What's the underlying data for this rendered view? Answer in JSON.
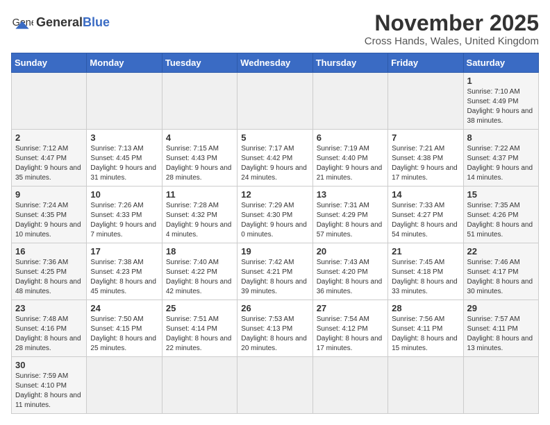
{
  "logo": {
    "text_general": "General",
    "text_blue": "Blue"
  },
  "header": {
    "month": "November 2025",
    "location": "Cross Hands, Wales, United Kingdom"
  },
  "weekdays": [
    "Sunday",
    "Monday",
    "Tuesday",
    "Wednesday",
    "Thursday",
    "Friday",
    "Saturday"
  ],
  "weeks": [
    [
      {
        "day": "",
        "info": ""
      },
      {
        "day": "",
        "info": ""
      },
      {
        "day": "",
        "info": ""
      },
      {
        "day": "",
        "info": ""
      },
      {
        "day": "",
        "info": ""
      },
      {
        "day": "",
        "info": ""
      },
      {
        "day": "1",
        "info": "Sunrise: 7:10 AM\nSunset: 4:49 PM\nDaylight: 9 hours and 38 minutes."
      }
    ],
    [
      {
        "day": "2",
        "info": "Sunrise: 7:12 AM\nSunset: 4:47 PM\nDaylight: 9 hours and 35 minutes."
      },
      {
        "day": "3",
        "info": "Sunrise: 7:13 AM\nSunset: 4:45 PM\nDaylight: 9 hours and 31 minutes."
      },
      {
        "day": "4",
        "info": "Sunrise: 7:15 AM\nSunset: 4:43 PM\nDaylight: 9 hours and 28 minutes."
      },
      {
        "day": "5",
        "info": "Sunrise: 7:17 AM\nSunset: 4:42 PM\nDaylight: 9 hours and 24 minutes."
      },
      {
        "day": "6",
        "info": "Sunrise: 7:19 AM\nSunset: 4:40 PM\nDaylight: 9 hours and 21 minutes."
      },
      {
        "day": "7",
        "info": "Sunrise: 7:21 AM\nSunset: 4:38 PM\nDaylight: 9 hours and 17 minutes."
      },
      {
        "day": "8",
        "info": "Sunrise: 7:22 AM\nSunset: 4:37 PM\nDaylight: 9 hours and 14 minutes."
      }
    ],
    [
      {
        "day": "9",
        "info": "Sunrise: 7:24 AM\nSunset: 4:35 PM\nDaylight: 9 hours and 10 minutes."
      },
      {
        "day": "10",
        "info": "Sunrise: 7:26 AM\nSunset: 4:33 PM\nDaylight: 9 hours and 7 minutes."
      },
      {
        "day": "11",
        "info": "Sunrise: 7:28 AM\nSunset: 4:32 PM\nDaylight: 9 hours and 4 minutes."
      },
      {
        "day": "12",
        "info": "Sunrise: 7:29 AM\nSunset: 4:30 PM\nDaylight: 9 hours and 0 minutes."
      },
      {
        "day": "13",
        "info": "Sunrise: 7:31 AM\nSunset: 4:29 PM\nDaylight: 8 hours and 57 minutes."
      },
      {
        "day": "14",
        "info": "Sunrise: 7:33 AM\nSunset: 4:27 PM\nDaylight: 8 hours and 54 minutes."
      },
      {
        "day": "15",
        "info": "Sunrise: 7:35 AM\nSunset: 4:26 PM\nDaylight: 8 hours and 51 minutes."
      }
    ],
    [
      {
        "day": "16",
        "info": "Sunrise: 7:36 AM\nSunset: 4:25 PM\nDaylight: 8 hours and 48 minutes."
      },
      {
        "day": "17",
        "info": "Sunrise: 7:38 AM\nSunset: 4:23 PM\nDaylight: 8 hours and 45 minutes."
      },
      {
        "day": "18",
        "info": "Sunrise: 7:40 AM\nSunset: 4:22 PM\nDaylight: 8 hours and 42 minutes."
      },
      {
        "day": "19",
        "info": "Sunrise: 7:42 AM\nSunset: 4:21 PM\nDaylight: 8 hours and 39 minutes."
      },
      {
        "day": "20",
        "info": "Sunrise: 7:43 AM\nSunset: 4:20 PM\nDaylight: 8 hours and 36 minutes."
      },
      {
        "day": "21",
        "info": "Sunrise: 7:45 AM\nSunset: 4:18 PM\nDaylight: 8 hours and 33 minutes."
      },
      {
        "day": "22",
        "info": "Sunrise: 7:46 AM\nSunset: 4:17 PM\nDaylight: 8 hours and 30 minutes."
      }
    ],
    [
      {
        "day": "23",
        "info": "Sunrise: 7:48 AM\nSunset: 4:16 PM\nDaylight: 8 hours and 28 minutes."
      },
      {
        "day": "24",
        "info": "Sunrise: 7:50 AM\nSunset: 4:15 PM\nDaylight: 8 hours and 25 minutes."
      },
      {
        "day": "25",
        "info": "Sunrise: 7:51 AM\nSunset: 4:14 PM\nDaylight: 8 hours and 22 minutes."
      },
      {
        "day": "26",
        "info": "Sunrise: 7:53 AM\nSunset: 4:13 PM\nDaylight: 8 hours and 20 minutes."
      },
      {
        "day": "27",
        "info": "Sunrise: 7:54 AM\nSunset: 4:12 PM\nDaylight: 8 hours and 17 minutes."
      },
      {
        "day": "28",
        "info": "Sunrise: 7:56 AM\nSunset: 4:11 PM\nDaylight: 8 hours and 15 minutes."
      },
      {
        "day": "29",
        "info": "Sunrise: 7:57 AM\nSunset: 4:11 PM\nDaylight: 8 hours and 13 minutes."
      }
    ],
    [
      {
        "day": "30",
        "info": "Sunrise: 7:59 AM\nSunset: 4:10 PM\nDaylight: 8 hours and 11 minutes."
      },
      {
        "day": "",
        "info": ""
      },
      {
        "day": "",
        "info": ""
      },
      {
        "day": "",
        "info": ""
      },
      {
        "day": "",
        "info": ""
      },
      {
        "day": "",
        "info": ""
      },
      {
        "day": "",
        "info": ""
      }
    ]
  ]
}
